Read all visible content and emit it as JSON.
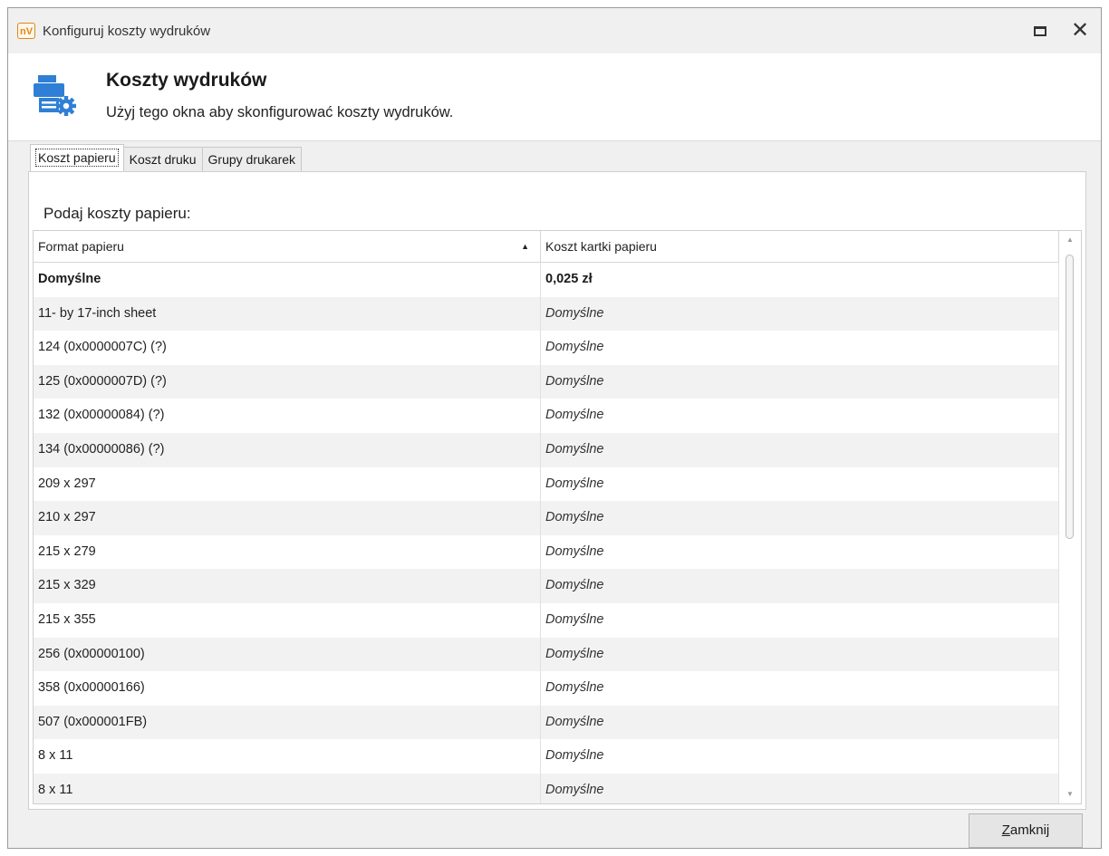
{
  "window": {
    "title": "Konfiguruj koszty wydruków",
    "app_badge": "nV"
  },
  "header": {
    "title": "Koszty wydruków",
    "subtitle": "Użyj tego okna aby skonfigurować koszty wydruków.",
    "icon": "printer-settings-icon"
  },
  "tabs": [
    {
      "label": "Koszt papieru",
      "active": true
    },
    {
      "label": "Koszt druku",
      "active": false
    },
    {
      "label": "Grupy drukarek",
      "active": false
    }
  ],
  "panel": {
    "label": "Podaj koszty papieru:"
  },
  "grid": {
    "columns": [
      "Format papieru",
      "Koszt kartki papieru"
    ],
    "sort": "ascending",
    "rows": [
      {
        "format": "Domyślne",
        "cost": "0,025 zł",
        "bold": true
      },
      {
        "format": "11- by 17-inch sheet",
        "cost": "Domyślne"
      },
      {
        "format": "124 (0x0000007C) (?)",
        "cost": "Domyślne"
      },
      {
        "format": "125 (0x0000007D) (?)",
        "cost": "Domyślne"
      },
      {
        "format": "132 (0x00000084) (?)",
        "cost": "Domyślne"
      },
      {
        "format": "134 (0x00000086) (?)",
        "cost": "Domyślne"
      },
      {
        "format": "209 x 297",
        "cost": "Domyślne"
      },
      {
        "format": "210 x 297",
        "cost": "Domyślne"
      },
      {
        "format": "215 x 279",
        "cost": "Domyślne"
      },
      {
        "format": "215 x 329",
        "cost": "Domyślne"
      },
      {
        "format": "215 x 355",
        "cost": "Domyślne"
      },
      {
        "format": "256 (0x00000100)",
        "cost": "Domyślne"
      },
      {
        "format": "358 (0x00000166)",
        "cost": "Domyślne"
      },
      {
        "format": "507 (0x000001FB)",
        "cost": "Domyślne"
      },
      {
        "format": "8 x 11",
        "cost": "Domyślne"
      },
      {
        "format": "8 x 11",
        "cost": "Domyślne"
      }
    ]
  },
  "footer": {
    "close_label": "Zamknij",
    "close_mnemonic": "Z",
    "close_rest": "amknij"
  },
  "colors": {
    "accent_blue": "#2f7fd6",
    "app_orange": "#e0861a"
  }
}
